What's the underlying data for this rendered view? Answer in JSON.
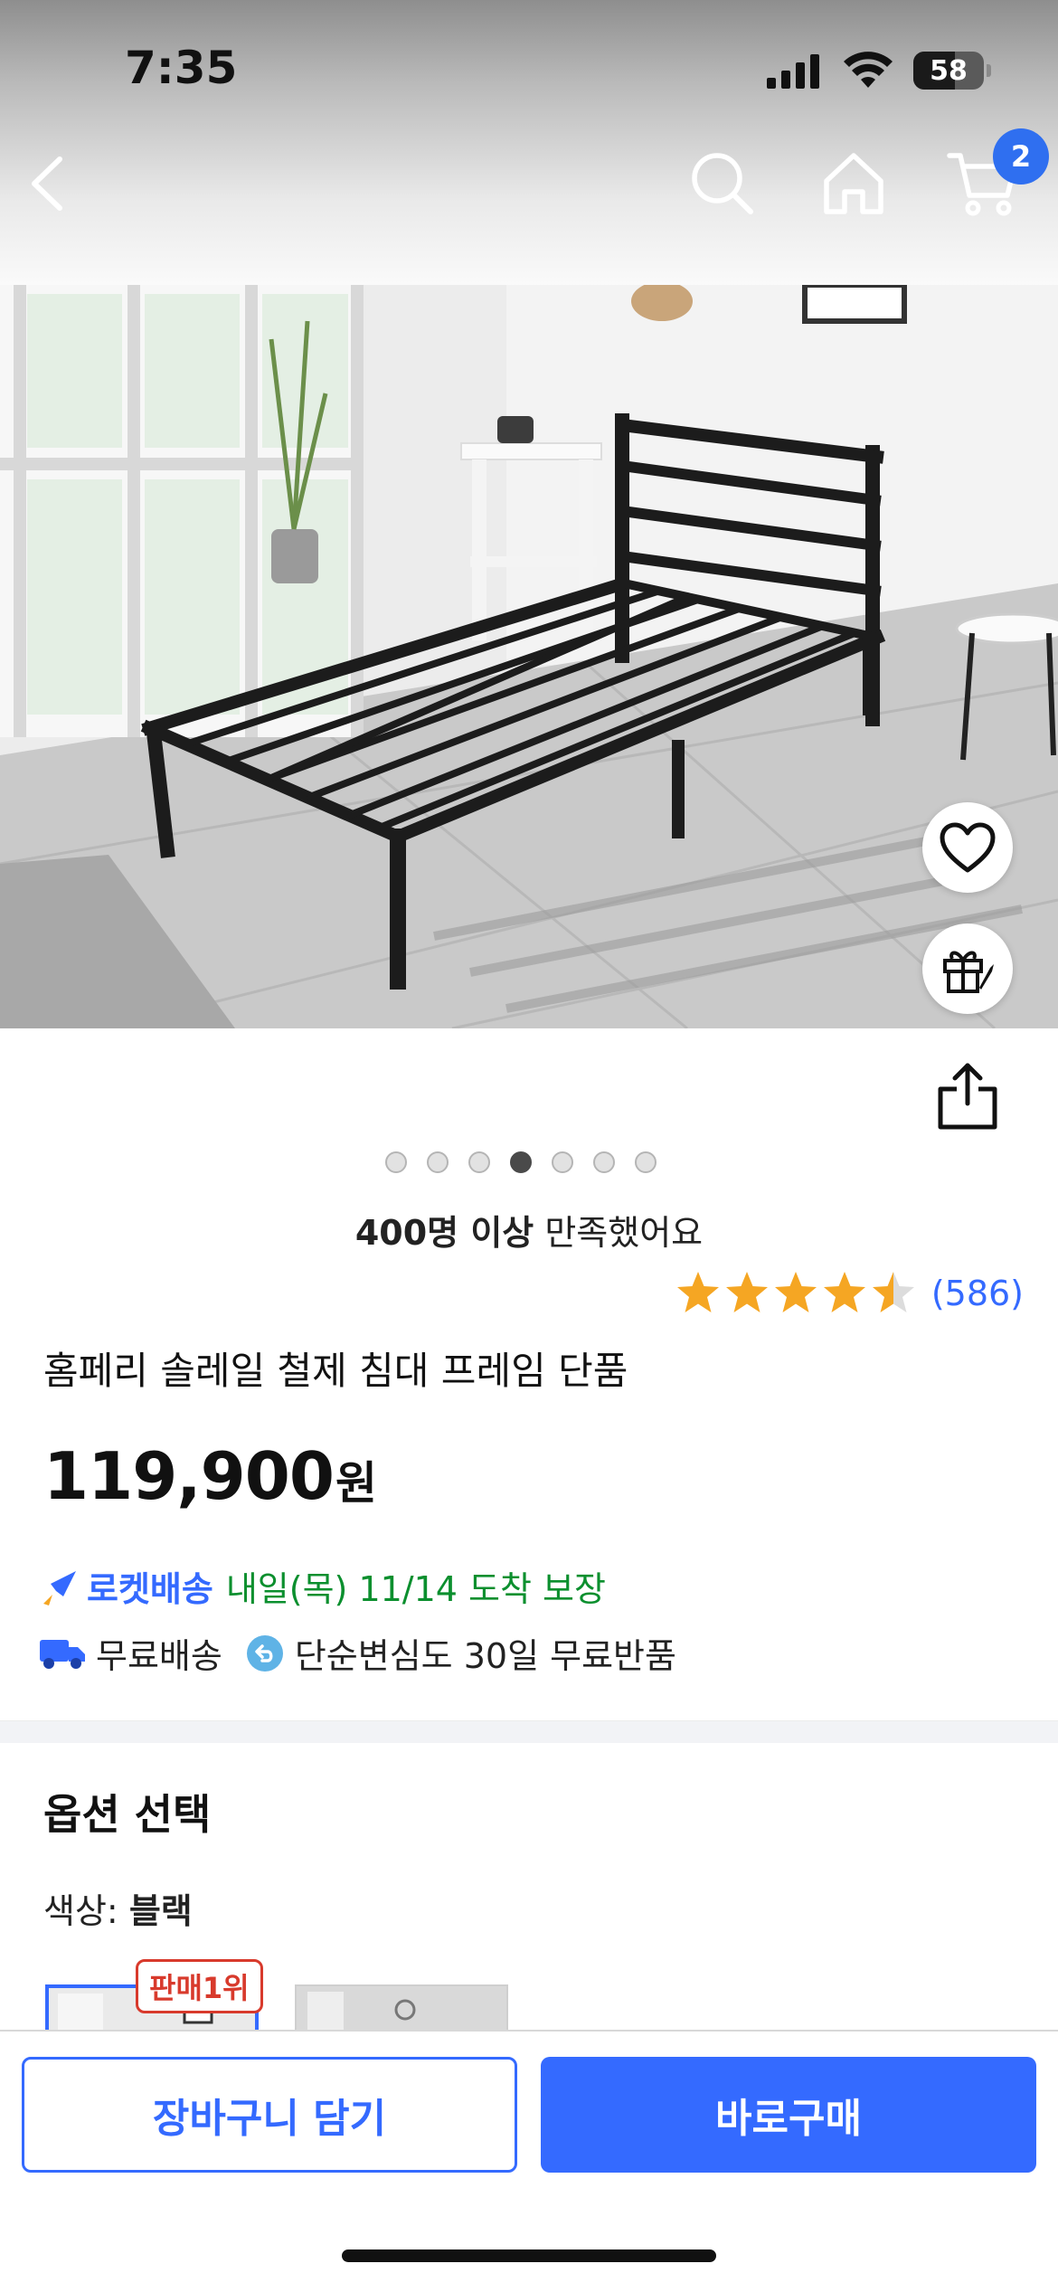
{
  "status_bar": {
    "time": "7:35",
    "battery": "58"
  },
  "header": {
    "cart_count": "2"
  },
  "gallery": {
    "total_images": 7,
    "current_index": 4
  },
  "product": {
    "satisfaction_bold": "400명 이상",
    "satisfaction_rest": " 만족했어요",
    "rating_value": 4.5,
    "review_count": "(586)",
    "title": "홈페리 솔레일 철제 침대 프레임 단품",
    "price": "119,900",
    "currency": "원"
  },
  "delivery": {
    "rocket_label": "로켓배송",
    "arrival": "내일(목) 11/14 도착 보장",
    "free_shipping": "무료배송",
    "free_return": "단순변심도 30일 무료반품"
  },
  "options": {
    "heading": "옵션 선택",
    "color_label": "색상: ",
    "color_value": "블랙",
    "best_badge": "판매1위"
  },
  "actions": {
    "add_to_cart": "장바구니 담기",
    "buy_now": "바로구매"
  },
  "colors": {
    "accent": "#346aff",
    "green": "#0b8f2e",
    "badge_red": "#d83a2c"
  }
}
